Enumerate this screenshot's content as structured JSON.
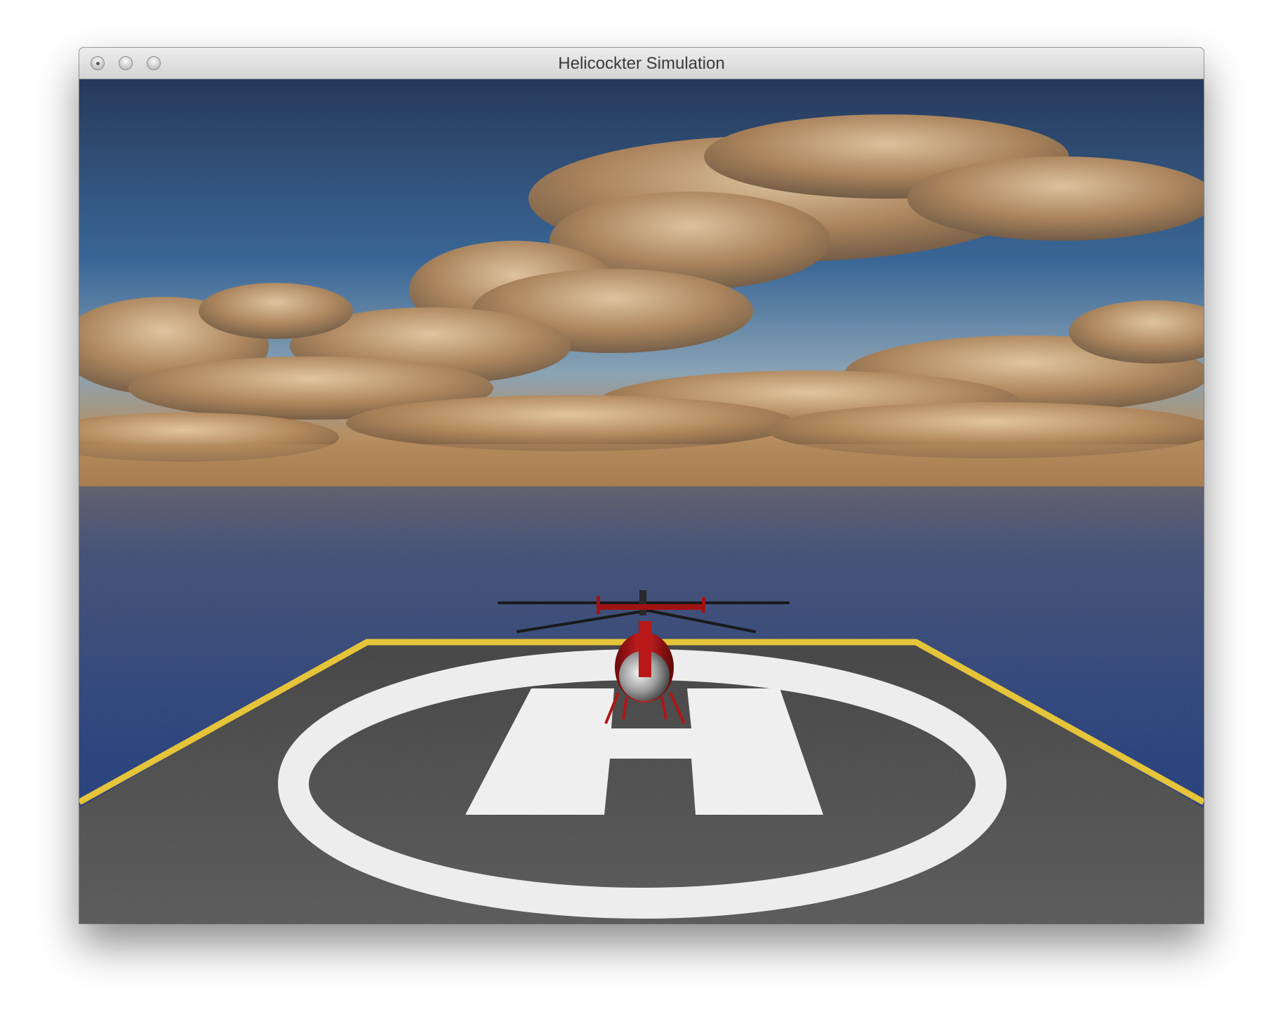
{
  "window": {
    "title": "Helicockter Simulation",
    "buttons": [
      "close-button",
      "minimize-button",
      "zoom-button"
    ]
  },
  "scene": {
    "description_tokens": [
      "sky",
      "clouds",
      "ocean",
      "helipad",
      "helipad-h-marking",
      "helicopter"
    ],
    "colors": {
      "sky_top": "#2a4166",
      "sky_mid": "#3d6a9c",
      "horizon": "#b08a5c",
      "ocean": "#1f3a7a",
      "helipad": "#4a4a4a",
      "edge_stripe": "#e2c23a",
      "marking": "#eeeeee",
      "helicopter": "#a11010"
    }
  }
}
